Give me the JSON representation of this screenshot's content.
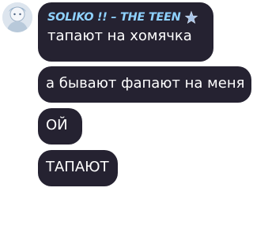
{
  "chat": {
    "sender": {
      "name": "SOLIKO !! – THE TEEN",
      "badge_icon": "star-icon",
      "name_color": "#8fd2ff",
      "avatar_icon": "avatar-icon"
    },
    "bubble_color": "#252231",
    "messages": [
      {
        "text": "тапают на хомячка"
      },
      {
        "text": "а бывают фапают на меня"
      },
      {
        "text": "ОЙ"
      },
      {
        "text": "ТАПАЮТ"
      }
    ]
  }
}
